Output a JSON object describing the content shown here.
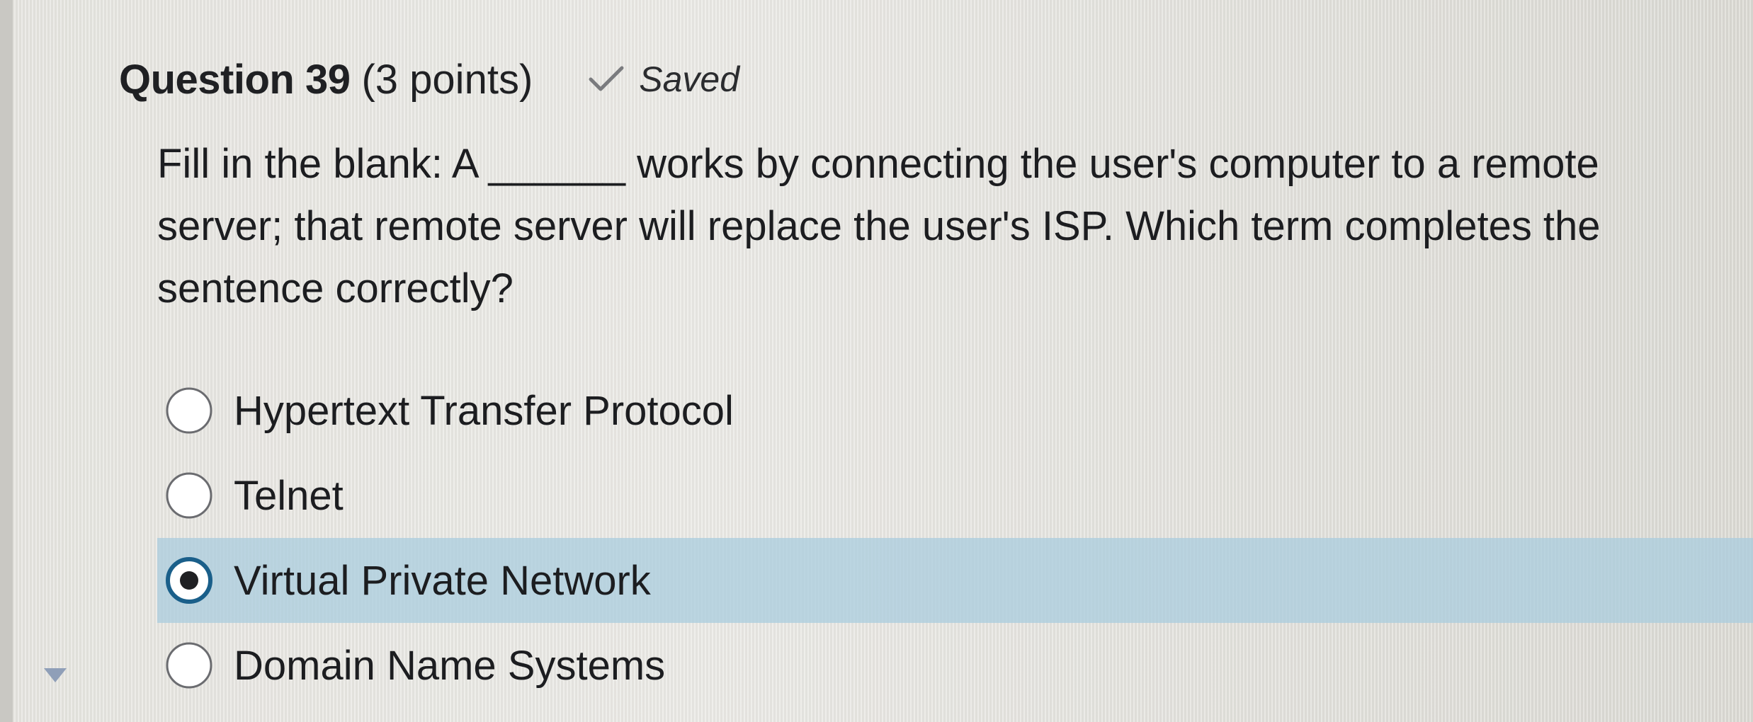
{
  "question": {
    "title": "Question 39",
    "points": "(3 points)",
    "status": "Saved",
    "status_icon": "checkmark-icon",
    "text": "Fill in the blank: A ______ works by connecting the user's computer to a remote server; that remote server will replace the user's ISP. Which term completes the sentence correctly?"
  },
  "options": [
    {
      "label": "Hypertext Transfer Protocol",
      "selected": false
    },
    {
      "label": "Telnet",
      "selected": false
    },
    {
      "label": "Virtual Private Network",
      "selected": true
    },
    {
      "label": "Domain Name Systems",
      "selected": false
    }
  ],
  "colors": {
    "selected_row": "#aaccde",
    "selected_radio_ring": "#1a5f8a",
    "text": "#1f2023",
    "check": "#7a7b7e"
  },
  "icons": {
    "collapse": "triangle-down-icon"
  }
}
